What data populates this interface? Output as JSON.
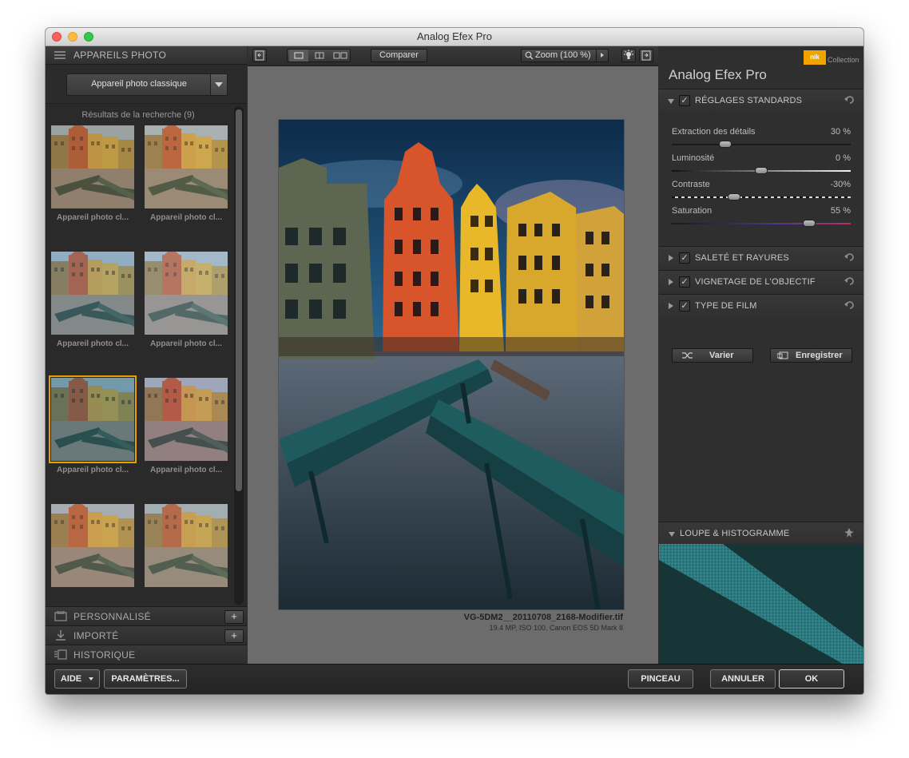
{
  "window": {
    "title": "Analog Efex Pro"
  },
  "left_panel": {
    "header": "APPAREILS PHOTO",
    "camera_dropdown": "Appareil photo classique",
    "results_label": "Résultats de la recherche (9)",
    "thumbnails": [
      {
        "caption": "Appareil photo cl..."
      },
      {
        "caption": "Appareil photo cl..."
      },
      {
        "caption": "Appareil photo cl..."
      },
      {
        "caption": "Appareil photo cl..."
      },
      {
        "caption": "Appareil photo cl..."
      },
      {
        "caption": "Appareil photo cl..."
      },
      {
        "caption": ""
      },
      {
        "caption": ""
      }
    ],
    "sections": [
      {
        "label": "PERSONNALISÉ",
        "action": "+"
      },
      {
        "label": "IMPORTÉ",
        "action": "+"
      },
      {
        "label": "HISTORIQUE",
        "action": ""
      }
    ]
  },
  "toolbar": {
    "compare_label": "Comparer",
    "zoom_label": "Zoom (100 %)"
  },
  "image_info": {
    "filename": "VG-5DM2__20110708_2168-Modifier.tif",
    "meta": "19.4 MP, ISO 100, Canon EOS 5D Mark II"
  },
  "right_panel": {
    "brand": "Analog Efex Pro",
    "logo_text": "nik",
    "collection_text": "Collection",
    "standard_section": "RÉGLAGES STANDARDS",
    "sliders": [
      {
        "label": "Extraction des détails",
        "value": "30 %",
        "level": 0.3
      },
      {
        "label": "Luminosité",
        "value": "0 %",
        "level": 0.5
      },
      {
        "label": "Contraste",
        "value": "-30%",
        "level": 0.35
      },
      {
        "label": "Saturation",
        "value": "55 %",
        "level": 0.77
      }
    ],
    "collapsed_sections": [
      "SALETÉ ET RAYURES",
      "VIGNETAGE DE L'OBJECTIF",
      "TYPE DE FILM"
    ],
    "vary_button": "Varier",
    "save_button": "Enregistrer",
    "loupe_section": "LOUPE & HISTOGRAMME"
  },
  "bottom_bar": {
    "help_button": "AIDE",
    "settings_button": "PARAMÈTRES...",
    "brush_button": "PINCEAU",
    "cancel_button": "ANNULER",
    "ok_button": "OK"
  },
  "colors": {
    "accent_orange": "#e8a000",
    "nik_logo": "#f0a400"
  }
}
